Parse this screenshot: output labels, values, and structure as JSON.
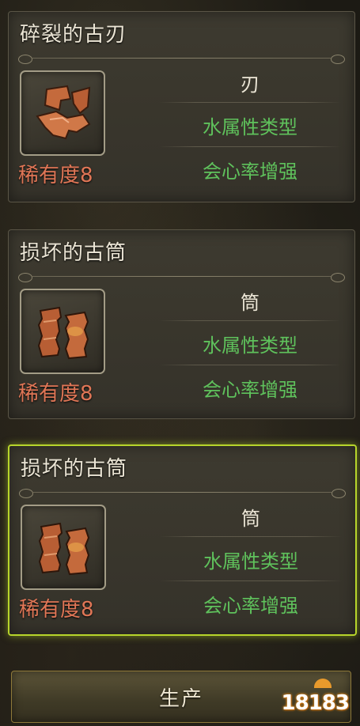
{
  "cards": [
    {
      "title": "碎裂的古刃",
      "icon": "broken-blade-icon",
      "rarity": "稀有度8",
      "weapon_type": "刃",
      "element": "水属性类型",
      "skill": "会心率增强",
      "selected": false
    },
    {
      "title": "损坏的古筒",
      "icon": "broken-barrel-icon",
      "rarity": "稀有度8",
      "weapon_type": "筒",
      "element": "水属性类型",
      "skill": "会心率增强",
      "selected": false
    },
    {
      "title": "损坏的古筒",
      "icon": "broken-barrel-icon",
      "rarity": "稀有度8",
      "weapon_type": "筒",
      "element": "水属性类型",
      "skill": "会心率增强",
      "selected": true
    }
  ],
  "produce_label": "生产",
  "watermark": "18183",
  "colors": {
    "rarity": "#e07656",
    "stat_green": "#5fc25c",
    "selected_border": "#b7d52b"
  }
}
